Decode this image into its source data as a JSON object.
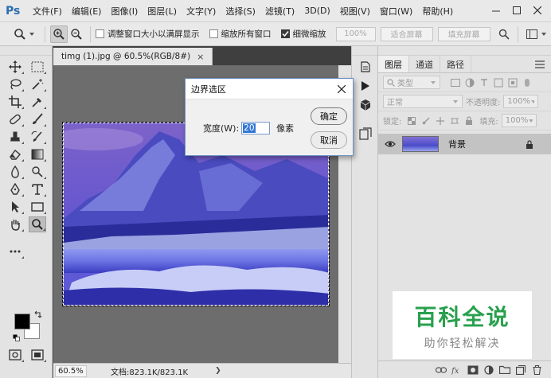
{
  "app": {
    "logo": "Ps"
  },
  "menu": [
    "文件(F)",
    "编辑(E)",
    "图像(I)",
    "图层(L)",
    "文字(Y)",
    "选择(S)",
    "滤镜(T)",
    "3D(D)",
    "视图(V)",
    "窗口(W)",
    "帮助(H)"
  ],
  "options": {
    "resize_windows": "调整窗口大小以满屏显示",
    "zoom_all": "缩放所有窗口",
    "scrubby_zoom": "细微缩放",
    "zoom_value": "100%",
    "fit_screen": "适合屏幕",
    "fill_screen": "填充屏幕"
  },
  "document": {
    "tab_title": "timg (1).jpg @ 60.5%(RGB/8#)",
    "close": "×",
    "zoom": "60.5%",
    "doc_info": "文档:823.1K/823.1K",
    "status_arrow": "❯"
  },
  "dialog": {
    "title": "边界选区",
    "width_label": "宽度(W):",
    "width_value": "20",
    "unit": "像素",
    "ok": "确定",
    "cancel": "取消"
  },
  "layers_panel": {
    "tabs": [
      "图层",
      "通道",
      "路径"
    ],
    "kind_filter": "类型",
    "blend_mode": "正常",
    "opacity_label": "不透明度:",
    "opacity_value": "100%",
    "lock_label": "锁定:",
    "fill_label": "填充:",
    "fill_value": "100%",
    "layer_name": "背景"
  },
  "watermark": {
    "title": "百科全说",
    "subtitle": "助你轻松解决"
  }
}
